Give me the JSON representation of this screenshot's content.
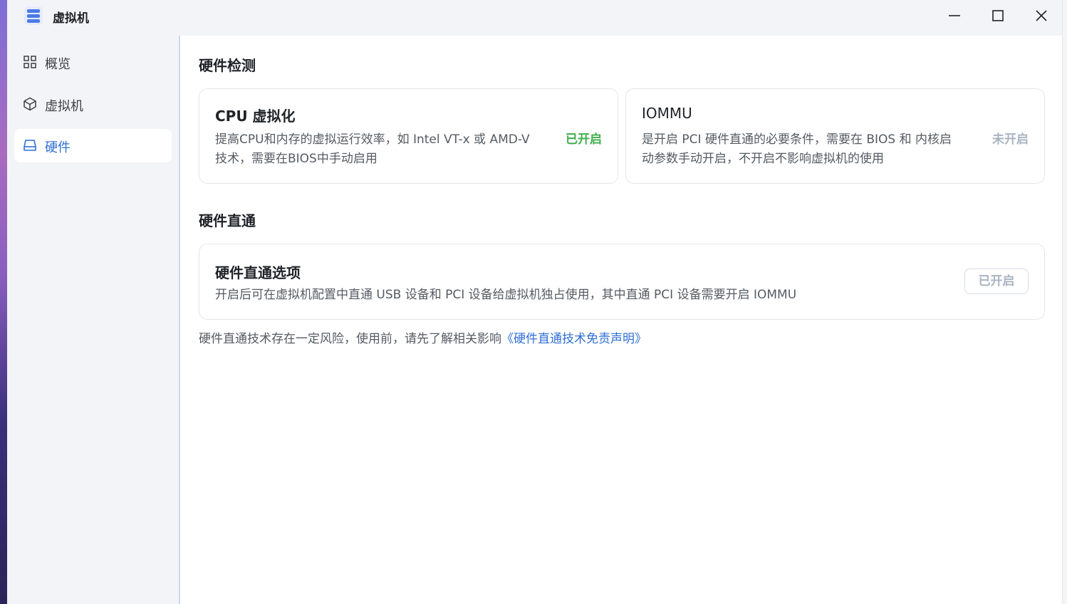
{
  "window": {
    "title": "虚拟机"
  },
  "sidebar": {
    "items": [
      {
        "label": "概览",
        "icon": "grid-icon",
        "active": false
      },
      {
        "label": "虚拟机",
        "icon": "cube-icon",
        "active": false
      },
      {
        "label": "硬件",
        "icon": "drive-icon",
        "active": true
      }
    ]
  },
  "hardware_detection": {
    "title": "硬件检测",
    "cpu": {
      "title": "CPU 虚拟化",
      "desc_line1": "提高CPU和内存的虚拟运行效率，如 Intel VT-x 或 AMD-V",
      "desc_line2": "技术，需要在BIOS中手动启用",
      "status": "已开启",
      "status_color": "#3fae4e"
    },
    "iommu": {
      "title": "IOMMU",
      "desc_line1": "是开启 PCI 硬件直通的必要条件，需要在 BIOS 和 内核启",
      "desc_line2": "动参数手动开启，不开启不影响虚拟机的使用",
      "status": "未开启",
      "status_color": "#a9b4c2"
    }
  },
  "passthrough": {
    "title": "硬件直通",
    "option": {
      "title": "硬件直通选项",
      "desc": "开启后可在虚拟机配置中直通 USB 设备和 PCI 设备给虚拟机独占使用，其中直通 PCI 设备需要开启 IOMMU",
      "button_label": "已开启"
    },
    "risk_note": "硬件直通技术存在一定风险，使用前，请先了解相关影响",
    "disclaimer_link": "《硬件直通技术免责声明》"
  },
  "colors": {
    "accent": "#2f6fd6",
    "enabled": "#3fae4e",
    "disabled": "#a9b4c2"
  }
}
